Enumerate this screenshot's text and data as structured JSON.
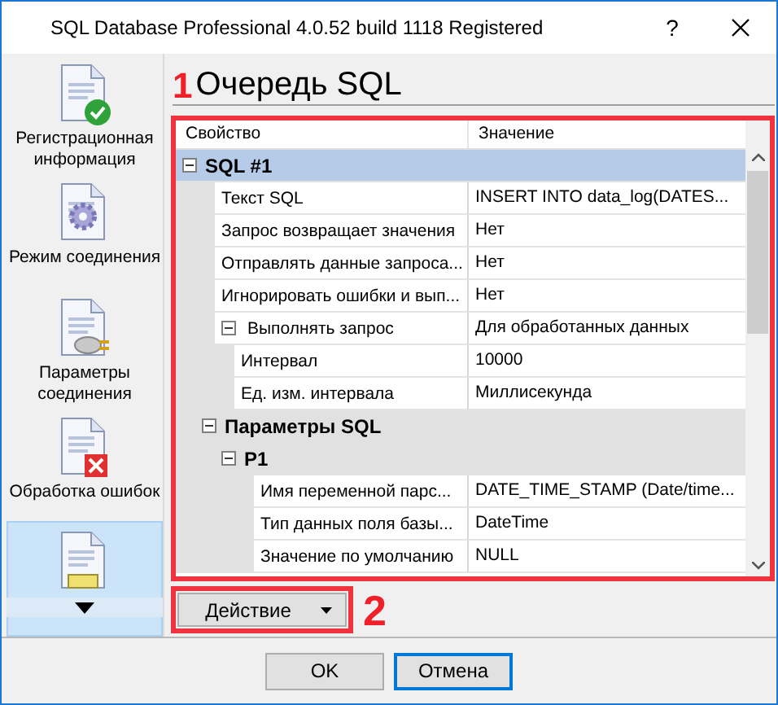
{
  "window": {
    "title": "SQL Database Professional 4.0.52 build 1118 Registered",
    "help": "?"
  },
  "sidebar": {
    "items": [
      {
        "label": "Регистрационная информация",
        "selected": false
      },
      {
        "label": "Режим соединения",
        "selected": false
      },
      {
        "label": "Параметры соединения",
        "selected": false
      },
      {
        "label": "Обработка ошибок",
        "selected": false
      },
      {
        "selected": true
      }
    ]
  },
  "page": {
    "heading": "Очередь SQL"
  },
  "grid": {
    "columns": [
      "Свойство",
      "Значение"
    ],
    "rows": [
      {
        "kind": "category",
        "name": "SQL #1",
        "selected": true,
        "expanded": true,
        "children": [
          {
            "kind": "property",
            "name": "Текст SQL",
            "value": "INSERT INTO data_log(DATES..."
          },
          {
            "kind": "property",
            "name": "Запрос возвращает значения",
            "value": "Нет"
          },
          {
            "kind": "property",
            "name": "Отправлять данные запроса...",
            "value": "Нет"
          },
          {
            "kind": "property",
            "name": "Игнорировать ошибки и вып...",
            "value": "Нет"
          },
          {
            "kind": "property",
            "name": "Выполнять запрос",
            "value": "Для обработанных данных",
            "expanded": true,
            "children": [
              {
                "kind": "property",
                "name": "Интервал",
                "value": "10000"
              },
              {
                "kind": "property",
                "name": "Ед. изм. интервала",
                "value": "Миллисекунда"
              }
            ]
          },
          {
            "kind": "category",
            "name": "Параметры SQL",
            "selected": false,
            "expanded": true,
            "children": [
              {
                "kind": "category",
                "name": "P1",
                "selected": false,
                "expanded": true,
                "children": [
                  {
                    "kind": "property",
                    "name": "Имя переменной парс...",
                    "value": "DATE_TIME_STAMP (Date/time..."
                  },
                  {
                    "kind": "property",
                    "name": "Тип данных поля базы...",
                    "value": "DateTime"
                  },
                  {
                    "kind": "property",
                    "name": "Значение по умолчанию",
                    "value": "NULL"
                  }
                ]
              }
            ]
          }
        ]
      }
    ]
  },
  "action_button": "Действие",
  "annotations": [
    {
      "label": "1"
    },
    {
      "label": "2"
    }
  ],
  "buttons": [
    {
      "label": "OK",
      "focused": false
    },
    {
      "label": "Отмена",
      "focused": true
    }
  ]
}
